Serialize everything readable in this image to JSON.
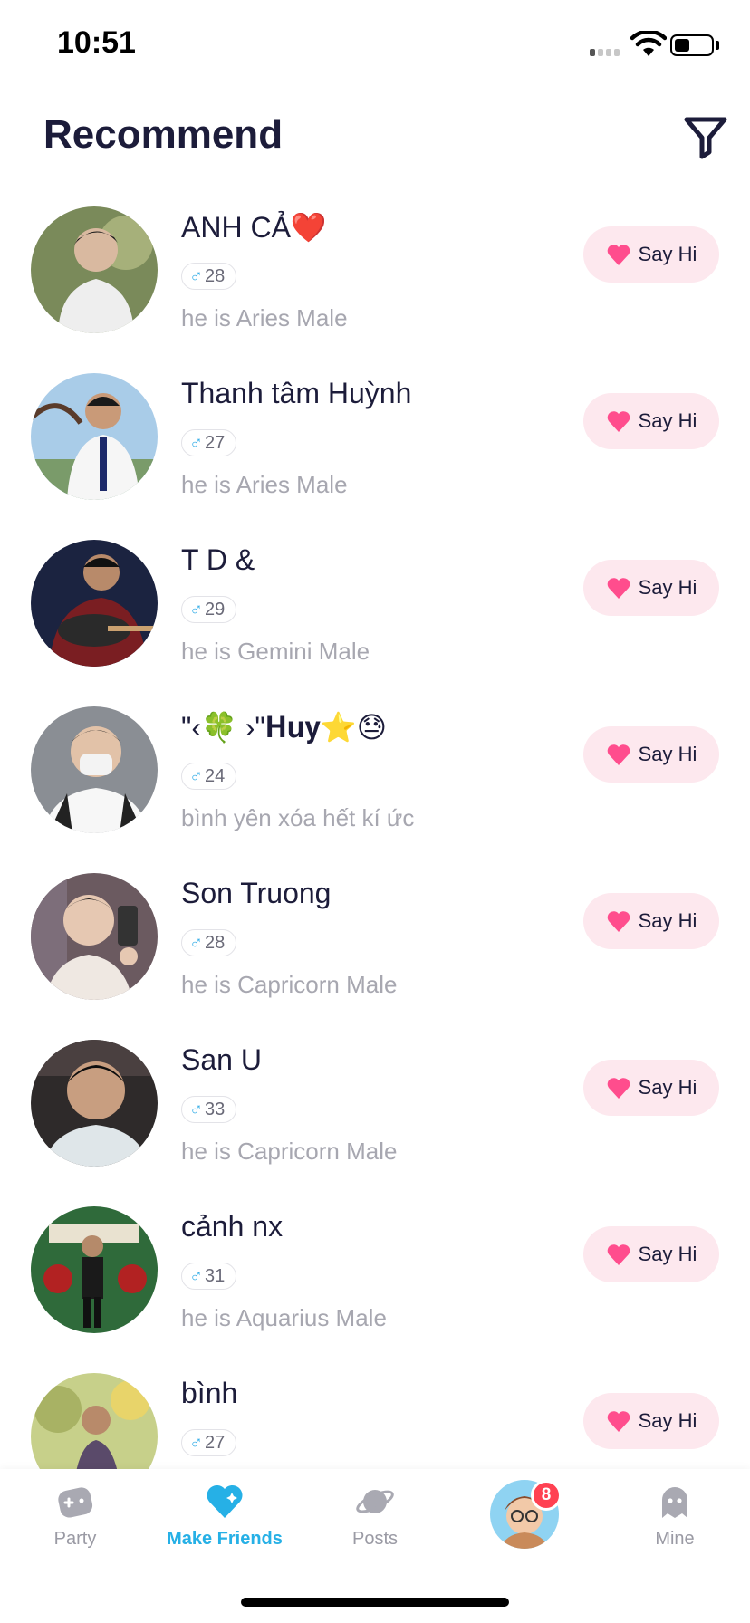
{
  "status_bar": {
    "time": "10:51"
  },
  "header": {
    "title": "Recommend",
    "filter_icon": "filter-icon"
  },
  "users": [
    {
      "name": "ANH CẢ❤️",
      "age": "28",
      "bio": "he is Aries Male",
      "say_hi": "Say Hi"
    },
    {
      "name": "Thanh tâm Huỳnh",
      "age": "27",
      "bio": "he is Aries Male",
      "say_hi": "Say Hi"
    },
    {
      "name": "T D &",
      "age": "29",
      "bio": "he is Gemini Male",
      "say_hi": "Say Hi"
    },
    {
      "name": "\"‹🍀 ›\"𝐇𝐮𝐲⭐😓",
      "age": "24",
      "bio": "bình yên xóa hết kí ức",
      "say_hi": "Say Hi"
    },
    {
      "name": "Son Truong",
      "age": "28",
      "bio": "he is Capricorn Male",
      "say_hi": "Say Hi"
    },
    {
      "name": "San U",
      "age": "33",
      "bio": "he is Capricorn Male",
      "say_hi": "Say Hi"
    },
    {
      "name": "cảnh nx",
      "age": "31",
      "bio": "he is Aquarius Male",
      "say_hi": "Say Hi"
    },
    {
      "name": "bình",
      "age": "27",
      "bio": "",
      "say_hi": "Say Hi"
    }
  ],
  "tabs": [
    {
      "label": "Party",
      "icon": "game-controller-icon",
      "active": false
    },
    {
      "label": "Make Friends",
      "icon": "heart-icon",
      "active": true
    },
    {
      "label": "Posts",
      "icon": "planet-icon",
      "active": false
    },
    {
      "label": "",
      "icon": "avatar",
      "active": false
    },
    {
      "label": "Mine",
      "icon": "ghost-icon",
      "active": false
    }
  ],
  "notification_count": "8",
  "colors": {
    "accent": "#26b0e6",
    "say_hi_bg": "#fde8ee",
    "heart": "#ff4d8d",
    "badge": "#ff4152"
  }
}
